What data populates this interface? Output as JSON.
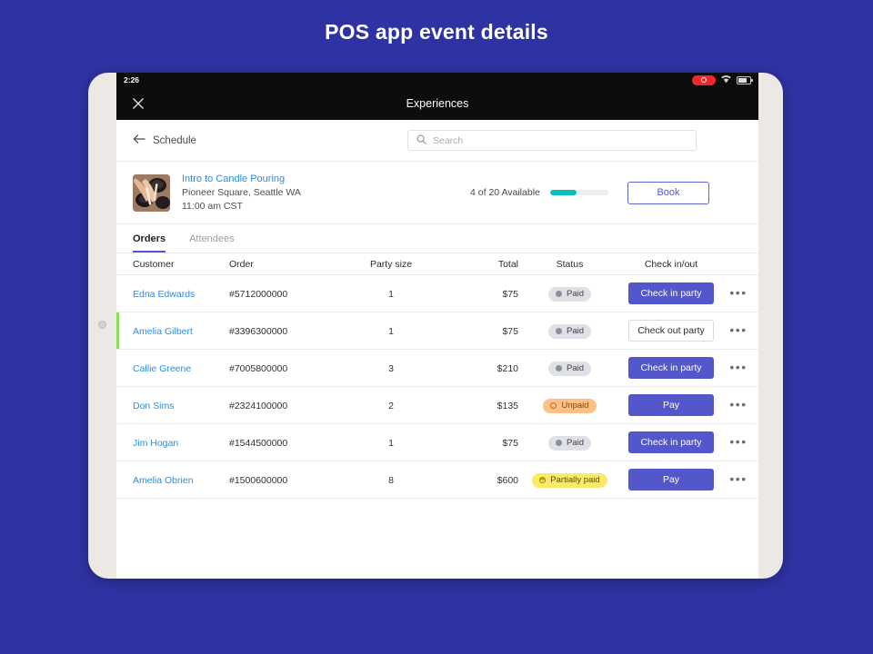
{
  "page": {
    "title": "POS app event details",
    "background_color": "#2f32a2"
  },
  "device": {
    "statusbar": {
      "time": "2:26",
      "recording_icon": "record-indicator-icon",
      "wifi_icon": "wifi-icon",
      "battery_icon": "battery-icon"
    },
    "navbar": {
      "close_icon": "close-icon",
      "title": "Experiences"
    }
  },
  "subheader": {
    "back_icon": "arrow-left-icon",
    "back_label": "Schedule",
    "search": {
      "icon": "search-icon",
      "value": "",
      "placeholder": "Search"
    }
  },
  "event": {
    "thumbnail_alt": "candle-pouring-photo",
    "title": "Intro to Candle Pouring",
    "location": "Pioneer Square, Seattle WA",
    "time": "11:00 am CST",
    "availability_text": "4 of 20 Available",
    "availability_percent": 45,
    "availability_bar_color": "#08bfbf",
    "book_label": "Book",
    "book_color": "#5457cc"
  },
  "tabs": [
    {
      "label": "Orders",
      "active": true
    },
    {
      "label": "Attendees",
      "active": false
    }
  ],
  "table": {
    "columns": [
      "Customer",
      "Order",
      "Party size",
      "Total",
      "Status",
      "Check in/out"
    ],
    "rows": [
      {
        "customer": "Edna Edwards",
        "order": "#5712000000",
        "party_size": "1",
        "total": "$75",
        "status": "Paid",
        "status_type": "paid",
        "action_label": "Check in party",
        "action_style": "primary",
        "checked_in": false,
        "more_icon": "more-options-icon"
      },
      {
        "customer": "Amelia Gilbert",
        "order": "#3396300000",
        "party_size": "1",
        "total": "$75",
        "status": "Paid",
        "status_type": "paid",
        "action_label": "Check out party",
        "action_style": "ghost",
        "checked_in": true,
        "more_icon": "more-options-icon"
      },
      {
        "customer": "Callie Greene",
        "order": "#7005800000",
        "party_size": "3",
        "total": "$210",
        "status": "Paid",
        "status_type": "paid",
        "action_label": "Check in party",
        "action_style": "primary",
        "checked_in": false,
        "more_icon": "more-options-icon"
      },
      {
        "customer": "Don Sims",
        "order": "#2324100000",
        "party_size": "2",
        "total": "$135",
        "status": "Unpaid",
        "status_type": "unpaid",
        "action_label": "Pay",
        "action_style": "primary",
        "checked_in": false,
        "more_icon": "more-options-icon"
      },
      {
        "customer": "Jim Hogan",
        "order": "#1544500000",
        "party_size": "1",
        "total": "$75",
        "status": "Paid",
        "status_type": "paid",
        "action_label": "Check in party",
        "action_style": "primary",
        "checked_in": false,
        "more_icon": "more-options-icon"
      },
      {
        "customer": "Amelia Obrien",
        "order": "#1500600000",
        "party_size": "8",
        "total": "$600",
        "status": "Partially paid",
        "status_type": "partial",
        "action_label": "Pay",
        "action_style": "primary",
        "checked_in": false,
        "more_icon": "more-options-icon"
      }
    ]
  }
}
